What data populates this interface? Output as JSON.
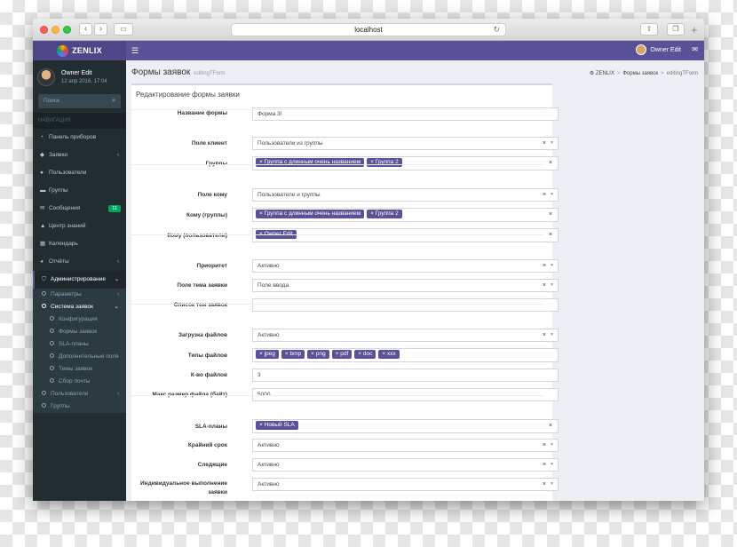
{
  "browser": {
    "url": "localhost"
  },
  "app": {
    "brand": "ZENLIX",
    "top_user": "Owner Edit"
  },
  "sidebar": {
    "user_name": "Owner Edit",
    "user_date": "12 апр 2016, 17:04",
    "search_placeholder": "Поиск",
    "header": "НАВИГАЦИЯ",
    "items": [
      {
        "label": "Панель приборов",
        "icon": "dashboard-icon"
      },
      {
        "label": "Заявки",
        "icon": "tag-icon"
      },
      {
        "label": "Пользователи",
        "icon": "users-icon"
      },
      {
        "label": "Группы",
        "icon": "folder-icon"
      },
      {
        "label": "Сообщения",
        "icon": "envelope-icon",
        "badge": "11"
      },
      {
        "label": "Центр знаний",
        "icon": "graduation-icon"
      },
      {
        "label": "Календарь",
        "icon": "calendar-icon"
      },
      {
        "label": "Отчёты",
        "icon": "pie-chart-icon"
      },
      {
        "label": "Администрирование",
        "icon": "shield-icon"
      }
    ],
    "sub": {
      "params": "Параметры",
      "system": "Система заявок",
      "children": [
        "Конфигурация",
        "Формы заявок",
        "SLA-планы",
        "Дополнительные поля",
        "Темы заявок",
        "Сбор почты"
      ],
      "users": "Пользователи",
      "groups": "Группы"
    }
  },
  "page": {
    "title": "Формы заявок",
    "subtitle": "editingTForm",
    "crumbs": [
      "ZENLIX",
      "Формы заявок",
      "editingTForm"
    ],
    "box_title": "Редактирование формы заявки"
  },
  "form": {
    "name_label": "Название формы",
    "name_value": "Форма 3!",
    "client_label": "Поле клиент",
    "client_value": "Пользователи из группы",
    "groups_label": "Группы",
    "groups_tags": [
      "× Группа с длинным очень названием",
      "× Группа 2"
    ],
    "to_label": "Поле кому",
    "to_value": "Пользователи и группы",
    "to_groups_label": "Кому (группы)",
    "to_groups_tags": [
      "× Группа с длинным очень названием",
      "× Группа 2"
    ],
    "to_users_label": "Кому (пользователи)",
    "to_users_tags": [
      "× Owner Edit"
    ],
    "priority_label": "Приоритет",
    "priority_value": "Активно",
    "subject_label": "Поле тема заявки",
    "subject_value": "Поле ввода",
    "subjects_label": "Список тем заявок",
    "subjects_value": "",
    "upload_label": "Загрузка файлов",
    "upload_value": "Активно",
    "types_label": "Типы файлов",
    "types_tags": [
      "× jpeg",
      "× bmp",
      "× png",
      "× pdf",
      "× doc",
      "× xxx"
    ],
    "count_label": "К-во файлов",
    "count_value": "3",
    "size_label": "Макс размер файла (байт)",
    "size_value": "5000",
    "sla_label": "SLA-планы",
    "sla_tags": [
      "× Новый SLA"
    ],
    "deadline_label": "Крайний срок",
    "deadline_value": "Активно",
    "watchers_label": "Следящие",
    "watchers_value": "Активно",
    "individual_label_1": "Индивидуальное выполнение",
    "individual_label_2": "заявки",
    "individual_value": "Активно"
  }
}
